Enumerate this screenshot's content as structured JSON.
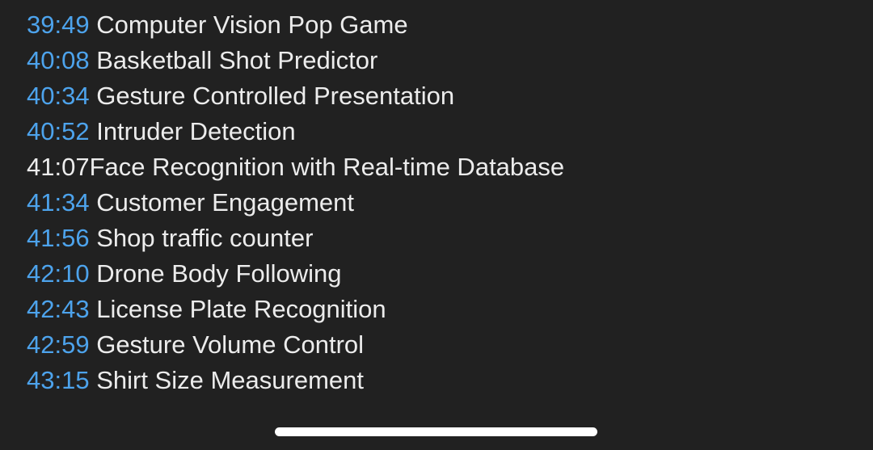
{
  "chapters": [
    {
      "time": "39:49",
      "title": "Computer Vision Pop Game"
    },
    {
      "time": "40:08",
      "title": "Basketball Shot Predictor"
    },
    {
      "time": "40:34",
      "title": "Gesture Controlled Presentation"
    },
    {
      "time": "40:52",
      "title": "Intruder Detection"
    },
    {
      "time": "41:07",
      "title": "Face Recognition with Real-time Database"
    },
    {
      "time": "41:34",
      "title": "Customer Engagement"
    },
    {
      "time": "41:56",
      "title": "Shop traffic counter"
    },
    {
      "time": "42:10",
      "title": "Drone Body Following"
    },
    {
      "time": "42:43",
      "title": "License Plate Recognition"
    },
    {
      "time": "42:59",
      "title": "Gesture Volume Control"
    },
    {
      "time": "43:15",
      "title": "Shirt Size Measurement"
    }
  ],
  "colors": {
    "background": "#212121",
    "timestamp_link": "#4da3ec",
    "text": "#ececec",
    "home_indicator": "#ffffff"
  }
}
